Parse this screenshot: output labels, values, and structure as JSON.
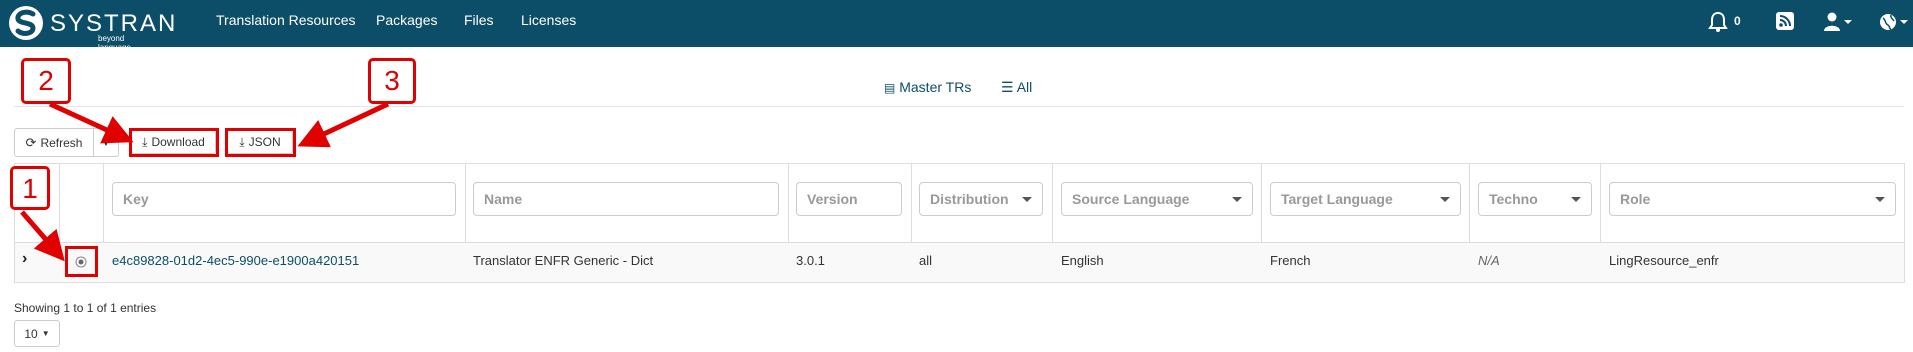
{
  "brand": {
    "name": "SYSTRAN",
    "tagline": "beyond language"
  },
  "nav": {
    "items": [
      "Translation Resources",
      "Packages",
      "Files",
      "Licenses"
    ],
    "notification_count": "0"
  },
  "views": {
    "master": "Master TRs",
    "all": "All"
  },
  "toolbar": {
    "refresh": "Refresh",
    "download": "Download",
    "json": "JSON"
  },
  "filters": {
    "key": "Key",
    "name": "Name",
    "version": "Version",
    "distribution": "Distribution",
    "source_language": "Source Language",
    "target_language": "Target Language",
    "techno": "Techno",
    "role": "Role"
  },
  "row": {
    "key": "e4c89828-01d2-4ec5-990e-e1900a420151",
    "name": "Translator ENFR Generic - Dict",
    "version": "3.0.1",
    "distribution": "all",
    "source_language": "English",
    "target_language": "French",
    "techno": "N/A",
    "role": "LingResource_enfr"
  },
  "footer": {
    "showing": "Showing 1 to 1 of 1 entries",
    "page_size": "10"
  },
  "annotations": {
    "callout1": "1",
    "callout2": "2",
    "callout3": "3"
  },
  "colors": {
    "navbar": "#0c4e68",
    "annotation": "#e00000",
    "link": "#0c4e68"
  },
  "icons": [
    "bell-icon",
    "rss-icon",
    "user-icon",
    "globe-icon",
    "refresh-icon",
    "download-icon",
    "list-icon",
    "archive-icon",
    "radio-icon",
    "chevron-right-icon"
  ]
}
